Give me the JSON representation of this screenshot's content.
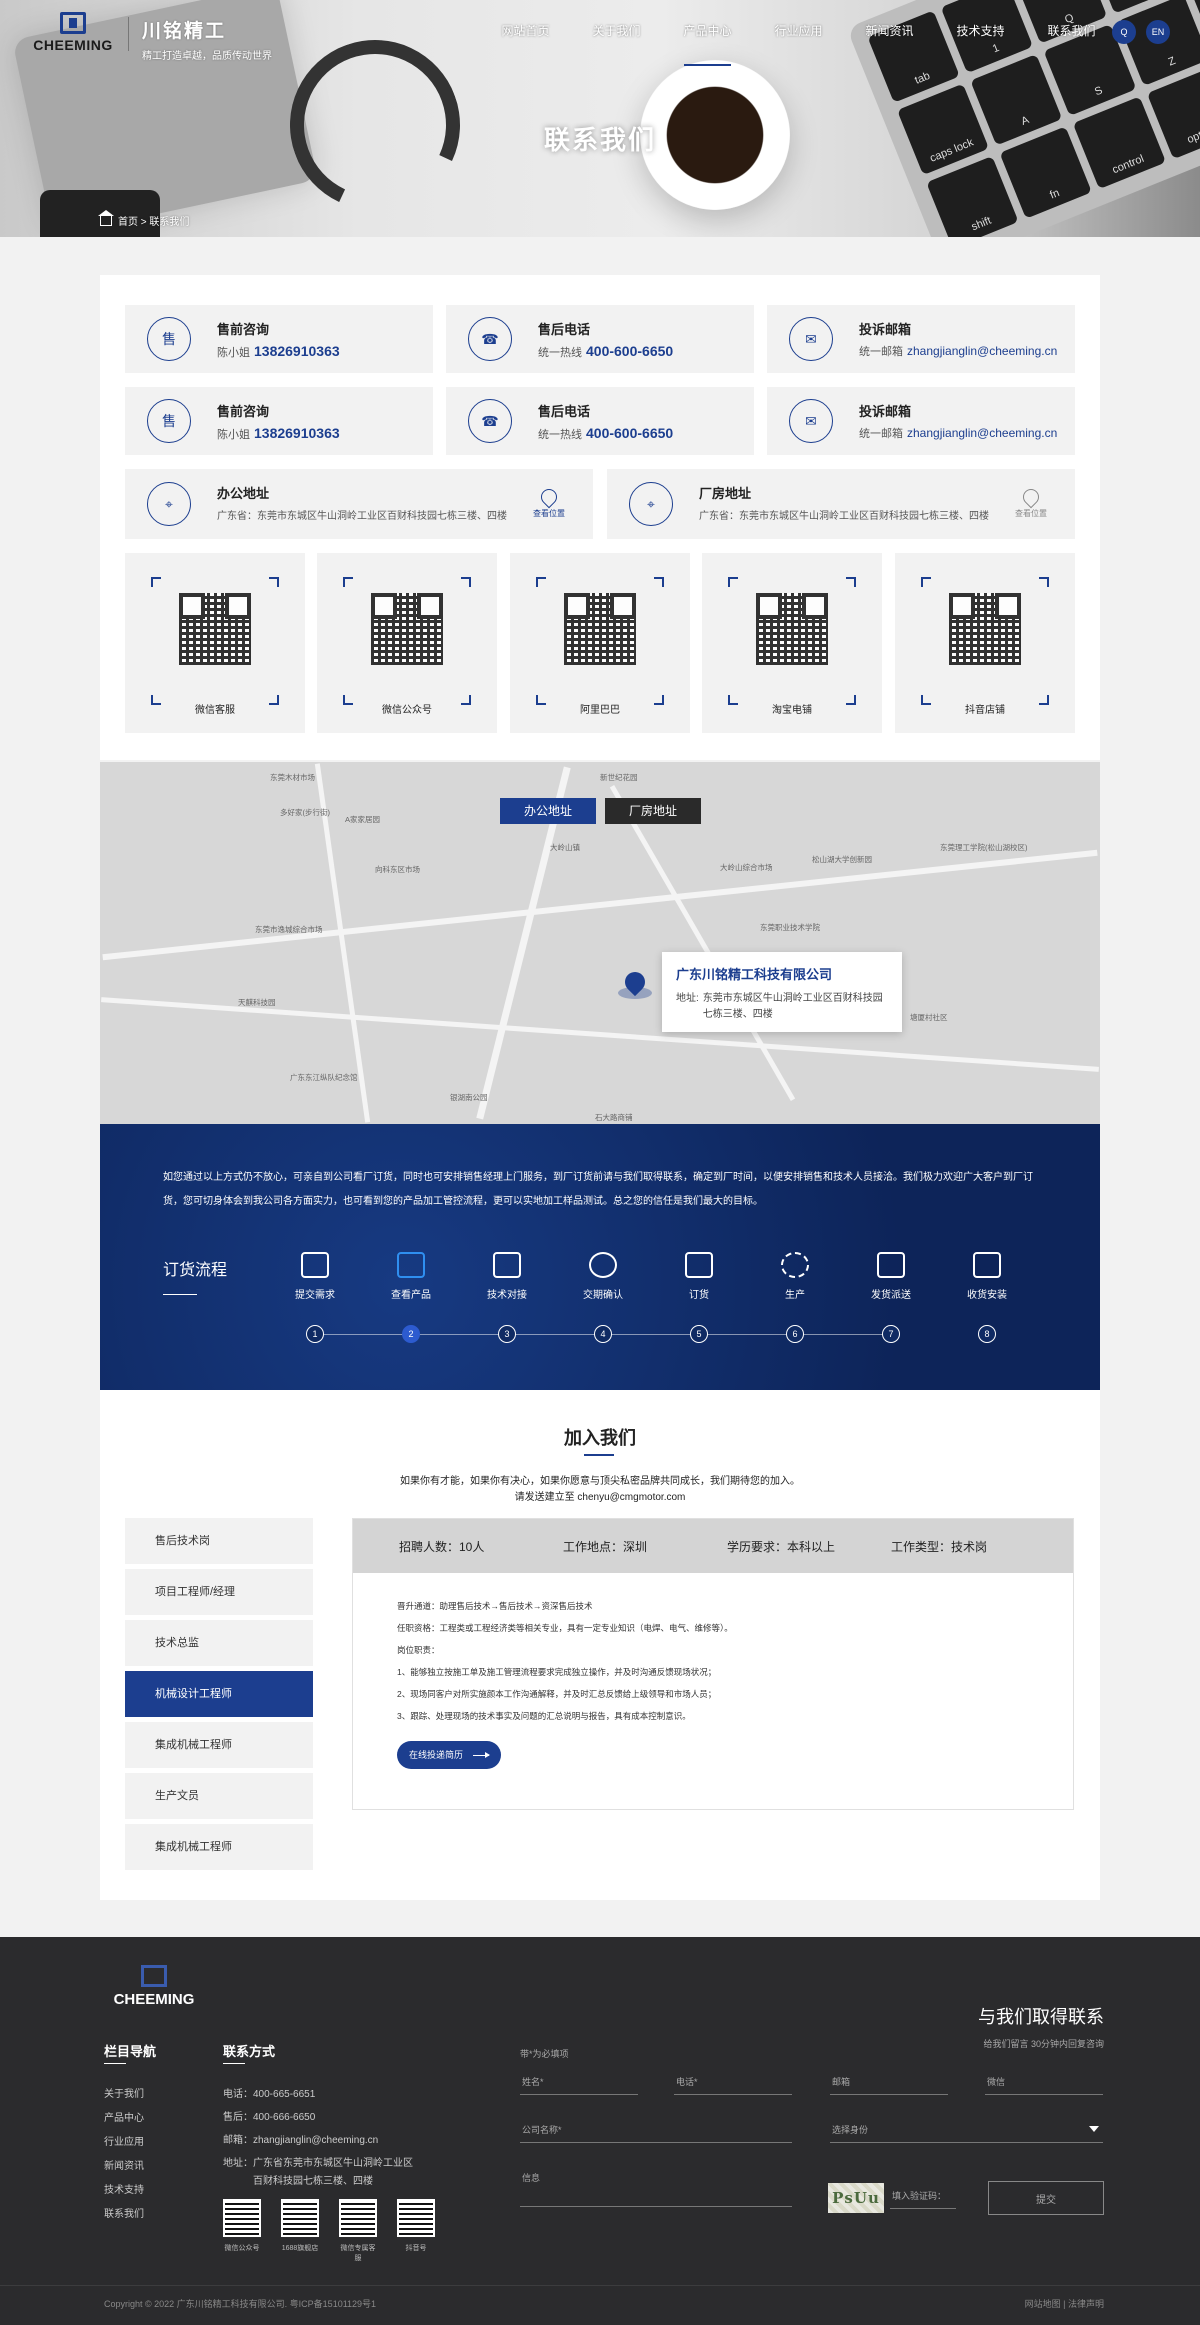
{
  "header": {
    "logo_word": "CHEEMING",
    "brand_cn": "川铭精工",
    "slogan": "精工打造卓越，品质传动世界",
    "nav": [
      "网站首页",
      "关于我们",
      "产品中心",
      "行业应用",
      "新闻资讯",
      "技术支持",
      "联系我们"
    ],
    "search_label": "Q",
    "lang_label": "EN"
  },
  "hero": {
    "title": "联系我们",
    "breadcrumb": "首页 > 联系我们"
  },
  "contact_cards": [
    {
      "title": "售前咨询",
      "prefix": "陈小姐",
      "value": "13826910363",
      "icon": "售"
    },
    {
      "title": "售后电话",
      "prefix": "统一热线",
      "value": "400-600-6650",
      "icon": "☎"
    },
    {
      "title": "投诉邮箱",
      "prefix": "统一邮箱",
      "value": "zhangjianglin@cheeming.cn",
      "icon": "✉"
    },
    {
      "title": "售前咨询",
      "prefix": "陈小姐",
      "value": "13826910363",
      "icon": "售"
    },
    {
      "title": "售后电话",
      "prefix": "统一热线",
      "value": "400-600-6650",
      "icon": "☎"
    },
    {
      "title": "投诉邮箱",
      "prefix": "统一邮箱",
      "value": "zhangjianglin@cheeming.cn",
      "icon": "✉"
    }
  ],
  "addresses": [
    {
      "title": "办公地址",
      "text": "广东省：东莞市东城区牛山洞岭工业区百财科技园七栋三楼、四楼",
      "button": "查看位置"
    },
    {
      "title": "厂房地址",
      "text": "广东省：东莞市东城区牛山洞岭工业区百财科技园七栋三楼、四楼",
      "button": "查看位置"
    }
  ],
  "qr_codes": [
    "微信客服",
    "微信公众号",
    "阿里巴巴",
    "淘宝电铺",
    "抖音店铺"
  ],
  "map": {
    "tab_office": "办公地址",
    "tab_factory": "厂房地址",
    "company": "广东川铭精工科技有限公司",
    "addr_label": "地址:",
    "addr_text": "东莞市东城区牛山洞岭工业区百财科技园七栋三楼、四楼",
    "labels": [
      "东莞木材市场",
      "新世纪花园",
      "多好家(步行街)",
      "A家家居园",
      "向科东区市场",
      "大岭山综合市场",
      "东莞市逸城综合市场",
      "东莞职业技术学院",
      "东莞理工学院(松山湖校区)",
      "松山湖大学创新园",
      "天麒科技园",
      "石大路商铺",
      "广东东江纵队纪念馆",
      "银湖南公园",
      "塘厦村社区",
      "大岭山镇"
    ]
  },
  "flow": {
    "intro": "如您通过以上方式仍不放心，可亲自到公司看厂订货，同时也可安排销售经理上门服务，到厂订货前请与我们取得联系，确定到厂时间，以便安排销售和技术人员接洽。我们极力欢迎广大客户到厂订货，您可切身体会到我公司各方面实力，也可看到您的产品加工管控流程，更可以实地加工样品测试。总之您的信任是我们最大的目标。",
    "title": "订货流程",
    "steps": [
      "提交需求",
      "查看产品",
      "技术对接",
      "交期确认",
      "订货",
      "生产",
      "发货派送",
      "收货安装"
    ],
    "nodes": [
      "1",
      "2",
      "3",
      "4",
      "5",
      "6",
      "7",
      "8"
    ],
    "active_step": 2
  },
  "join": {
    "title": "加入我们",
    "desc1": "如果你有才能，如果你有决心，如果你愿意与顶尖私密品牌共同成长，我们期待您的加入。",
    "desc2": "请发送建立至 chenyu@cmgmotor.com",
    "jobs": [
      "售后技术岗",
      "项目工程师/经理",
      "技术总监",
      "机械设计工程师",
      "集成机械工程师",
      "生产文员",
      "集成机械工程师"
    ],
    "active_job": 4,
    "head": [
      "招聘人数：10人",
      "工作地点：深圳",
      "学历要求：本科以上",
      "工作类型：技术岗"
    ],
    "lines": [
      "晋升通道：助理售后技术→售后技术→资深售后技术",
      "任职资格：工程类或工程经济类等相关专业，具有一定专业知识（电焊、电气、维修等）。",
      "岗位职责：",
      "1、能够独立按施工单及施工管理流程要求完成独立操作，并及时沟通反馈现场状况；",
      "2、现场同客户对所实施颜本工作沟通解释，并及时汇总反馈给上级领导和市场人员；",
      "3、跟踪、处理现场的技术事实及问题的汇总说明与报告，具有成本控制意识。"
    ],
    "apply": "在线投递简历"
  },
  "footer": {
    "logo_word": "CHEEMING",
    "nav_title": "栏目导航",
    "nav": [
      "关于我们",
      "产品中心",
      "行业应用",
      "新闻资讯",
      "技术支持",
      "联系我们"
    ],
    "contact_title": "联系方式",
    "contact": [
      "电话：400-665-6651",
      "售后：400-666-6650",
      "邮箱：zhangjianglin@cheeming.cn",
      "地址：广东省东莞市东城区牛山洞岭工业区",
      "百财科技园七栋三楼、四楼"
    ],
    "qrs": [
      "微信公众号",
      "1688旗舰店",
      "微信专属客服",
      "抖音号"
    ],
    "contact_head": "与我们取得联系",
    "contact_sub": "给我们留言 30分钟内回复咨询",
    "required": "带*为必填项",
    "fields": {
      "name": "姓名*",
      "phone": "电话*",
      "email": "邮箱",
      "wechat": "微信",
      "company": "公司名称*",
      "identity": "选择身份",
      "info": "信息",
      "captcha": "填入验证码："
    },
    "captcha_code": "PsUu",
    "submit": "提交",
    "copyright": "Copyright © 2022 广东川铭精工科技有限公司. 粤ICP备15101129号1",
    "links": "网站地图 | 法律声明"
  }
}
